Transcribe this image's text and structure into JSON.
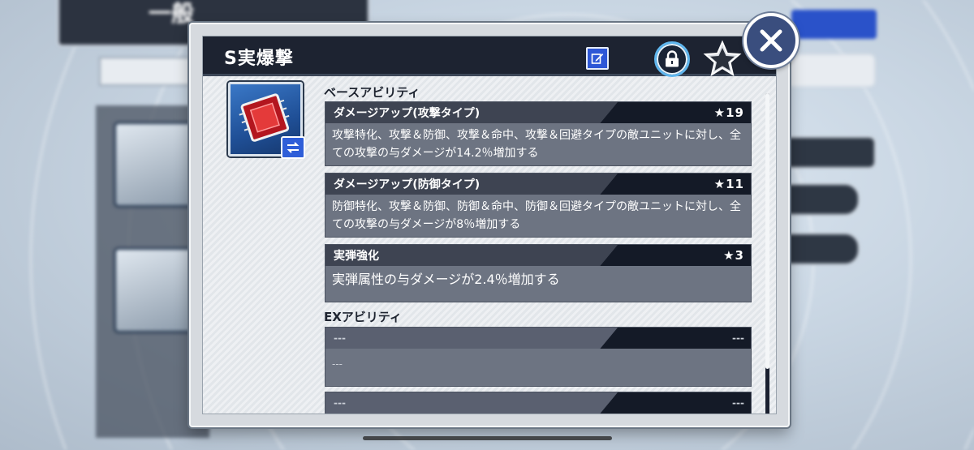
{
  "background": {
    "title": "一般"
  },
  "dialog": {
    "title": "S実爆撃",
    "edit_icon": "edit-icon",
    "lock_icon": "lock-icon",
    "favorite_icon": "star-icon",
    "close_icon": "close-icon",
    "item_icon": "chip-icon",
    "swap_icon": "swap-icon"
  },
  "base_abilities": {
    "label": "ベースアビリティ",
    "items": [
      {
        "name": "ダメージアップ(攻撃タイプ)",
        "stars": "★19",
        "description": "攻撃特化、攻撃＆防御、攻撃＆命中、攻撃＆回避タイプの敵ユニットに対し、全ての攻撃の与ダメージが14.2％増加する"
      },
      {
        "name": "ダメージアップ(防御タイプ)",
        "stars": "★11",
        "description": "防御特化、攻撃＆防御、防御＆命中、防御＆回避タイプの敵ユニットに対し、全ての攻撃の与ダメージが8％増加する"
      },
      {
        "name": "実弾強化",
        "stars": "★3",
        "description": "実弾属性の与ダメージが2.4％増加する"
      }
    ]
  },
  "ex_abilities": {
    "label": "EXアビリティ",
    "items": [
      {
        "name": "---",
        "stars": "---",
        "description": "---"
      },
      {
        "name": "---",
        "stars": "---"
      }
    ]
  },
  "colors": {
    "header": "#1d2331",
    "edit_button": "#2e57d6",
    "lock_ring": "#5fb6ee",
    "close_button": "#3a4e7e"
  }
}
